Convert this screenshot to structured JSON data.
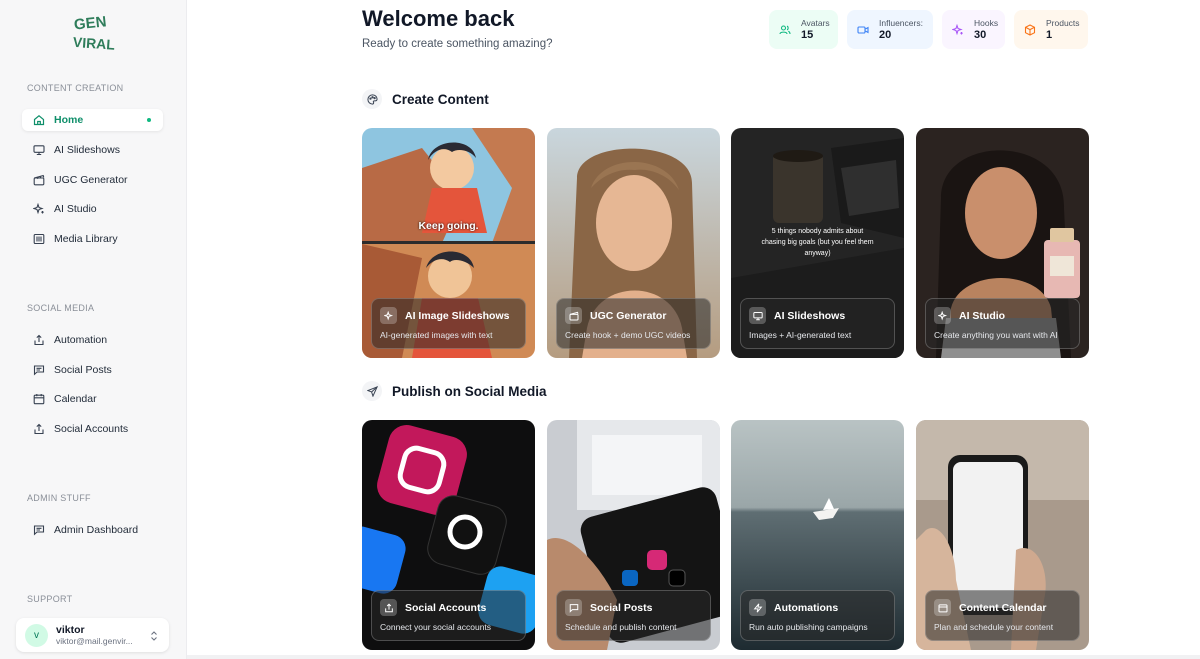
{
  "sidebar": {
    "logo_top": "GEN",
    "logo_bottom": "VIRAL",
    "sections": {
      "content_creation": "CONTENT CREATION",
      "social_media": "SOCIAL MEDIA",
      "admin_stuff": "ADMIN STUFF",
      "support": "SUPPORT"
    },
    "content_items": [
      {
        "label": "Home",
        "icon": "home-icon"
      },
      {
        "label": "AI Slideshows",
        "icon": "monitor-icon"
      },
      {
        "label": "UGC Generator",
        "icon": "clapperboard-icon"
      },
      {
        "label": "AI Studio",
        "icon": "sparkles-icon"
      },
      {
        "label": "Media Library",
        "icon": "library-icon"
      }
    ],
    "social_items": [
      {
        "label": "Automation",
        "icon": "share-icon"
      },
      {
        "label": "Social Posts",
        "icon": "message-square-icon"
      },
      {
        "label": "Calendar",
        "icon": "calendar-icon"
      },
      {
        "label": "Social Accounts",
        "icon": "share-icon"
      }
    ],
    "admin_items": [
      {
        "label": "Admin Dashboard",
        "icon": "message-square-icon"
      }
    ],
    "user": {
      "initial": "v",
      "name": "viktor",
      "email": "viktor@mail.genvir..."
    }
  },
  "header": {
    "title": "Welcome back",
    "subtitle": "Ready to create something amazing?"
  },
  "stats": [
    {
      "label": "Avatars",
      "value": "15",
      "icon": "users-icon",
      "bg": "#ecfdf5",
      "color": "#10b981"
    },
    {
      "label": "Influencers:",
      "value": "20",
      "icon": "video-icon",
      "bg": "#eff6ff",
      "color": "#3b82f6"
    },
    {
      "label": "Hooks",
      "value": "30",
      "icon": "sparkles-icon",
      "bg": "#faf5ff",
      "color": "#a855f7"
    },
    {
      "label": "Products",
      "value": "1",
      "icon": "package-icon",
      "bg": "#fff7ed",
      "color": "#f97316"
    }
  ],
  "create_section": {
    "title": "Create Content",
    "cards": [
      {
        "title": "AI Image Slideshows",
        "desc": "AI-generated images with text",
        "icon": "sparkles-icon",
        "caption": "Keep going."
      },
      {
        "title": "UGC Generator",
        "desc": "Create hook + demo UGC videos",
        "icon": "clapperboard-icon"
      },
      {
        "title": "AI Slideshows",
        "desc": "Images + AI-generated text",
        "icon": "monitor-icon",
        "caption": "5 things nobody admits about chasing big goals (but you feel them anyway)"
      },
      {
        "title": "AI Studio",
        "desc": "Create anything you want with AI",
        "icon": "sparkles-icon"
      }
    ]
  },
  "publish_section": {
    "title": "Publish on Social Media",
    "cards": [
      {
        "title": "Social Accounts",
        "desc": "Connect your social accounts",
        "icon": "share-icon"
      },
      {
        "title": "Social Posts",
        "desc": "Schedule and publish content",
        "icon": "message-square-icon"
      },
      {
        "title": "Automations",
        "desc": "Run auto publishing campaigns",
        "icon": "zap-icon"
      },
      {
        "title": "Content Calendar",
        "desc": "Plan and schedule your content",
        "icon": "calendar-icon"
      }
    ]
  }
}
